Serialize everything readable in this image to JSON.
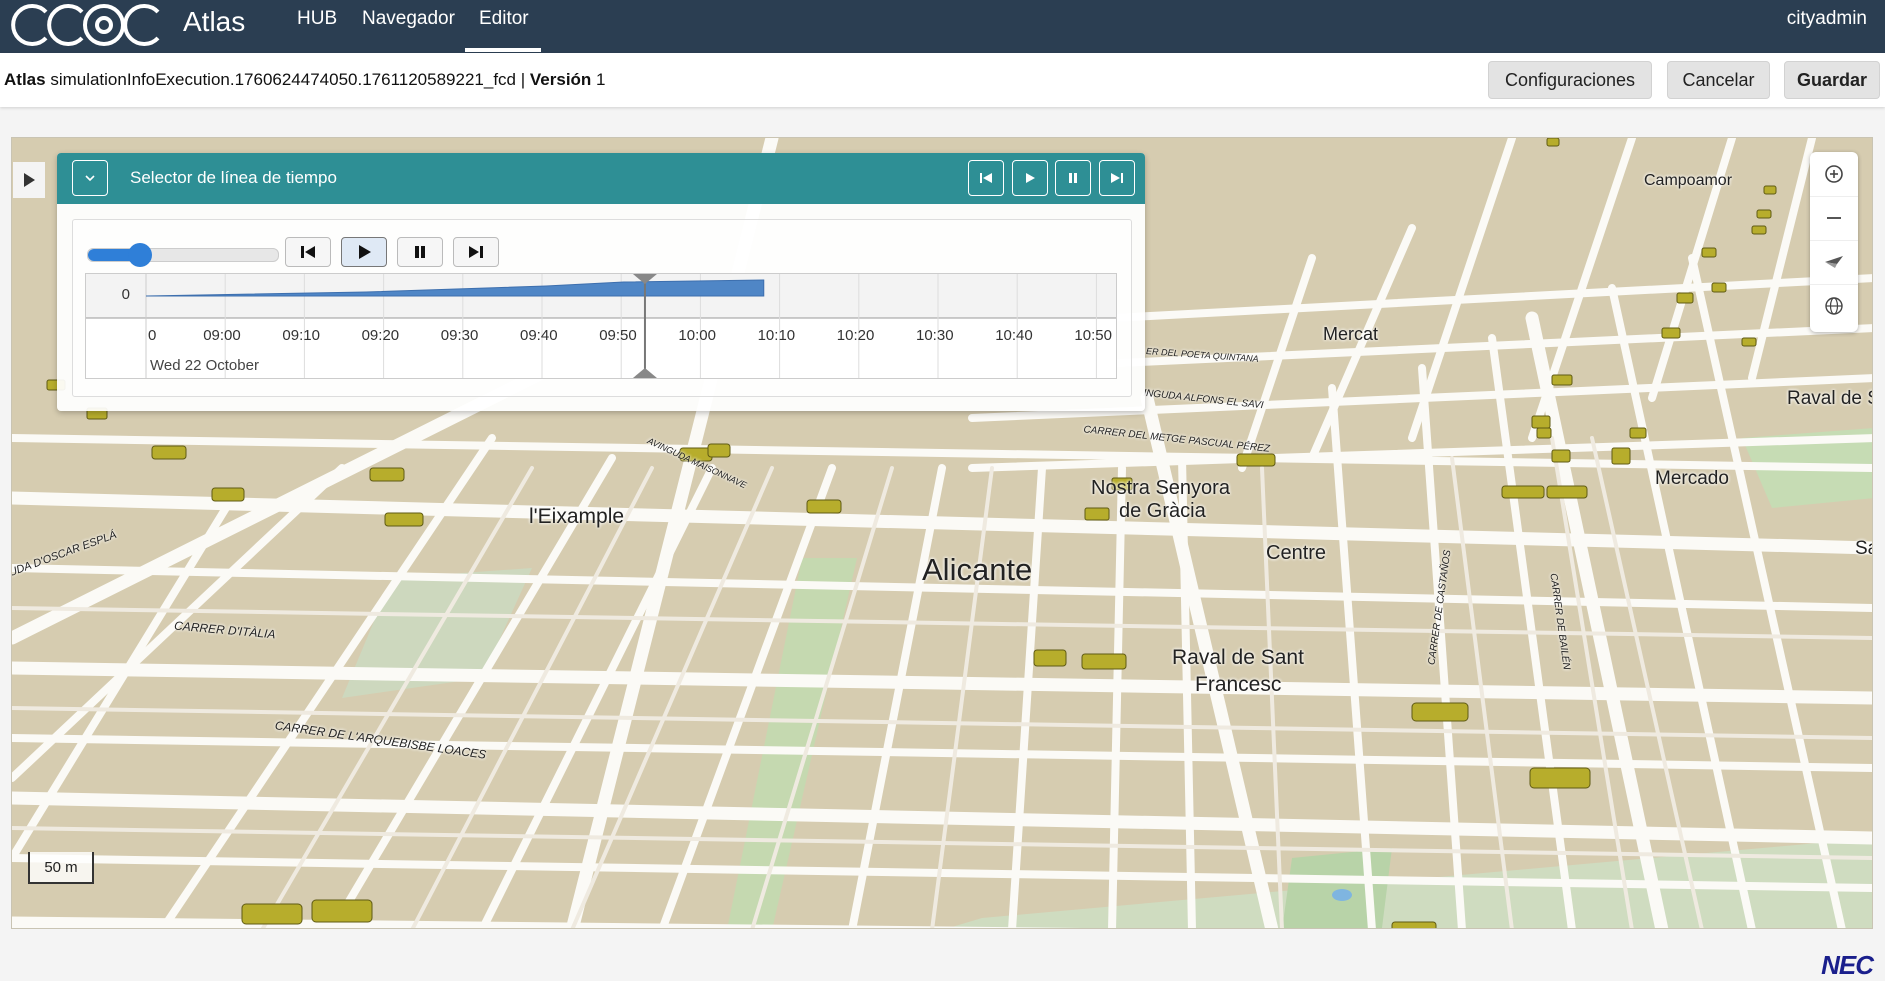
{
  "header": {
    "logo_text": "CCOC",
    "app_title": "Atlas",
    "nav": [
      "HUB",
      "Navegador",
      "Editor"
    ],
    "active_nav": "Editor",
    "user": "cityadmin"
  },
  "infobar": {
    "app": "Atlas",
    "file": "simulationInfoExecution.1760624474050.1761120589221_fcd",
    "version_label": "Versión",
    "version": "1",
    "buttons": {
      "settings": "Configuraciones",
      "cancel": "Cancelar",
      "save": "Guardar"
    }
  },
  "timeline": {
    "title": "Selector de línea de tiempo",
    "y_label": "0",
    "ticks": [
      "0",
      "09:00",
      "09:10",
      "09:20",
      "09:30",
      "09:40",
      "09:50",
      "10:00",
      "10:10",
      "10:20",
      "10:30",
      "10:40",
      "10:50"
    ],
    "date": "Wed 22 October",
    "cursor_time": "09:53",
    "data_end": "10:08"
  },
  "map": {
    "labels": {
      "alicante": "Alicante",
      "eixample": "l'Eixample",
      "centre": "Centre",
      "raval1": "Raval de Sant",
      "raval2": "Francesc",
      "senyora1": "Nostra Senyora",
      "senyora2": "de Gràcia",
      "mercat": "Mercat",
      "mercado": "Mercado",
      "campoamor": "Campoamor",
      "raval_s": "Raval de S",
      "sa": "Sa",
      "carrer_italia": "CARRER D'ITÀLIA",
      "arquebisbe": "CARRER DE L'ARQUEBISBE LOACES",
      "oscar": "UDA D'OSCAR ESPLÁ",
      "alfons": "INGUDA ALFONS EL SAVI",
      "metge": "CARRER DEL METGE PASCUAL PÉREZ",
      "maisonnave": "AVINGUDA MAISONNAVE",
      "castanos": "CARRER DE CASTAÑOS",
      "bailen": "CARRER DE BAILÉN",
      "quintana": "ER DEL POETA QUINTANA"
    },
    "scale": "50 m"
  },
  "brand": "NEC"
}
